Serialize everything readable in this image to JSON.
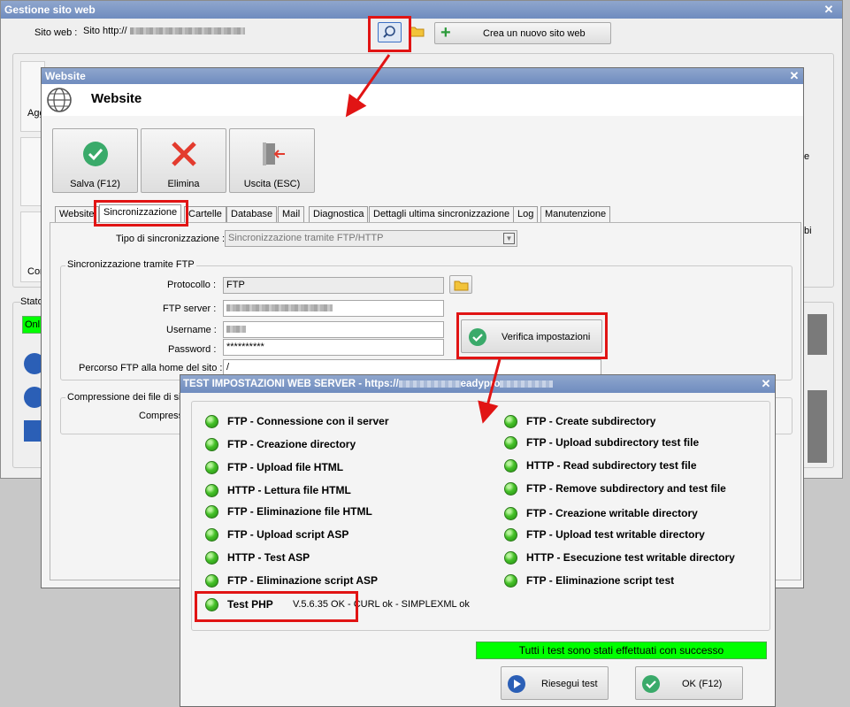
{
  "main_window": {
    "title": "Gestione sito web",
    "close_label": "✕",
    "site_label": "Sito web :",
    "site_value": "Sito http://",
    "search_icon": "search-icon",
    "folder_icon": "folder-icon",
    "new_site_button": "Crea un nuovo sito web",
    "left_partial_labels": [
      "Agg",
      "Con",
      "Stato",
      "Onl"
    ],
    "right_partial_labels": [
      "e",
      "bi"
    ]
  },
  "website_dialog": {
    "titlebar": "Website",
    "close_label": "✕",
    "header_title": "Website",
    "header_icon": "globe-icon",
    "toolbar": [
      {
        "label": "Salva (F12)",
        "icon": "check-icon"
      },
      {
        "label": "Elimina",
        "icon": "delete-x-icon"
      },
      {
        "label": "Uscita (ESC)",
        "icon": "exit-door-icon"
      }
    ],
    "tabs": [
      "Website",
      "Sincronizzazione",
      "Cartelle",
      "Database",
      "Mail",
      "Diagnostica",
      "Dettagli ultima sincronizzazione",
      "Log",
      "Manutenzione"
    ],
    "active_tab": "Sincronizzazione",
    "sync_type_label": "Tipo di sincronizzazione :",
    "sync_type_value": "Sincronizzazione tramite FTP/HTTP",
    "ftp_group_title": "Sincronizzazione tramite FTP",
    "protocol_label": "Protocollo :",
    "protocol_value": "FTP",
    "ftp_server_label": "FTP server :",
    "username_label": "Username :",
    "password_label": "Password :",
    "password_value": "**********",
    "path_label": "Percorso FTP alla home del sito :",
    "path_value": "/",
    "verify_button": "Verifica impostazioni",
    "compression_group_title": "Compressione dei file di sin",
    "compression_label": "Compress"
  },
  "test_dialog": {
    "title": "TEST IMPOSTAZIONI WEB SERVER - https://",
    "title_suffix": "eadypro",
    "close_label": "✕",
    "left_tests": [
      "FTP - Connessione con il server",
      "FTP - Creazione directory",
      "FTP - Upload file HTML",
      "HTTP - Lettura file HTML",
      "FTP - Eliminazione file HTML",
      "FTP - Upload script ASP",
      "HTTP - Test ASP",
      "FTP - Eliminazione script ASP"
    ],
    "right_tests": [
      "FTP - Create subdirectory",
      "FTP - Upload subdirectory test file",
      "HTTP - Read subdirectory test file",
      "FTP - Remove subdirectory and test file",
      "FTP - Creazione writable directory",
      "FTP - Upload test writable directory",
      "HTTP - Esecuzione test writable directory",
      "FTP - Eliminazione script test"
    ],
    "php_test_label": "Test PHP",
    "php_test_result": "V.5.6.35 OK - CURL ok - SIMPLEXML ok",
    "success_message": "Tutti i test sono stati effettuati con successo",
    "rerun_button": "Riesegui test",
    "ok_button": "OK (F12)"
  },
  "colors": {
    "titlebar": "#7c96c6",
    "annotation_red": "#e11414",
    "status_green": "#00ff00",
    "success_icon_green": "#3aaa6a",
    "delete_red": "#e33b2e"
  }
}
